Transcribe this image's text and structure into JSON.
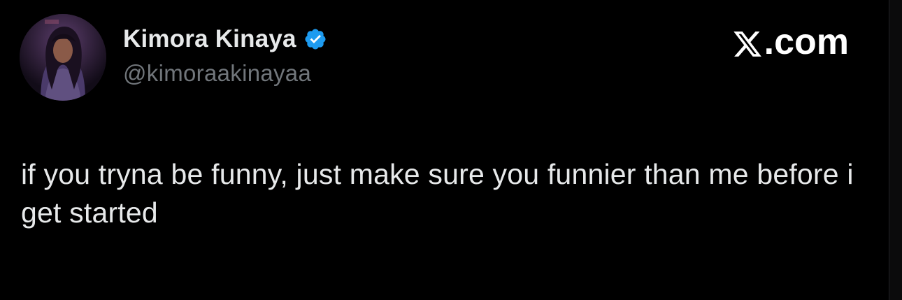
{
  "author": {
    "display_name": "Kimora Kinaya",
    "handle": "@kimoraakinayaa",
    "verified": true,
    "verified_badge_color": "#1d9bf0"
  },
  "brand": {
    "x_glyph": "𝕏",
    "label": ".com"
  },
  "tweet": {
    "text": "if you tryna be funny, just make sure you funnier than me before i get started"
  },
  "colors": {
    "background": "#000000",
    "primary_text": "#e7e9ea",
    "secondary_text": "#71767b",
    "brand_text": "#ffffff"
  }
}
